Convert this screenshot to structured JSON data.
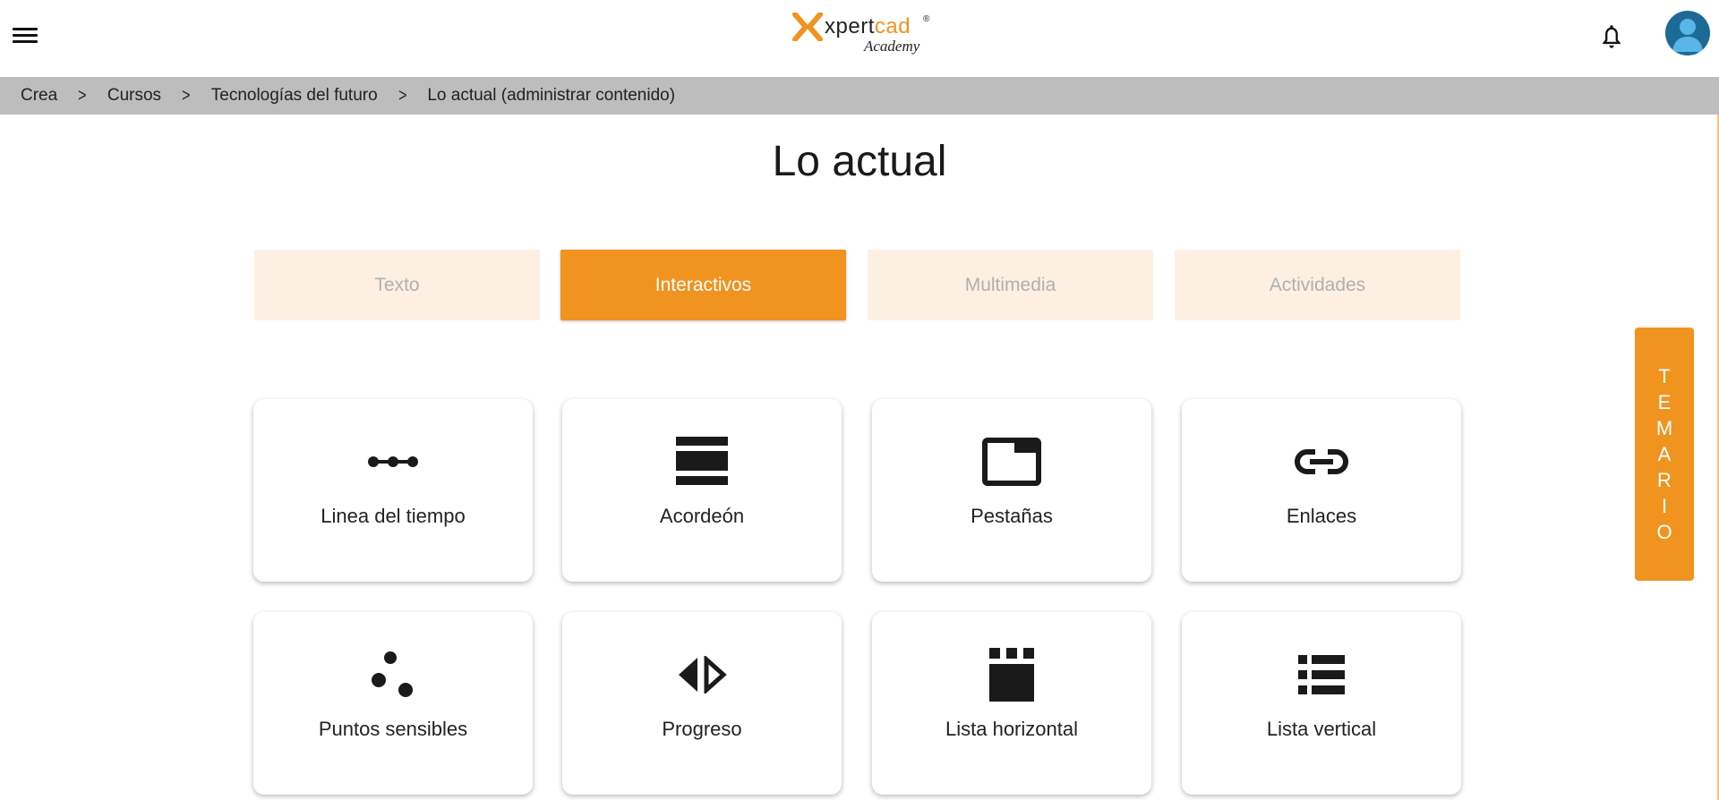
{
  "header": {
    "logo": {
      "brand_dark": "xpert",
      "brand_orange": "cad",
      "reg": "®",
      "sub": "Academy"
    },
    "menu_icon": "hamburger-icon",
    "notification_icon": "bell-icon",
    "avatar_icon": "user-avatar-icon"
  },
  "breadcrumb": {
    "items": [
      "Crea",
      "Cursos",
      "Tecnologías del futuro",
      "Lo actual (administrar contenido)"
    ],
    "separator": ">"
  },
  "page": {
    "title": "Lo actual"
  },
  "tabs": [
    {
      "label": "Texto",
      "active": false
    },
    {
      "label": "Interactivos",
      "active": true
    },
    {
      "label": "Multimedia",
      "active": false
    },
    {
      "label": "Actividades",
      "active": false
    }
  ],
  "cards": [
    {
      "label": "Linea del tiempo",
      "icon": "timeline-icon"
    },
    {
      "label": "Acordeón",
      "icon": "accordion-icon"
    },
    {
      "label": "Pestañas",
      "icon": "tabs-icon"
    },
    {
      "label": "Enlaces",
      "icon": "link-icon"
    },
    {
      "label": "Puntos sensibles",
      "icon": "hotspots-icon"
    },
    {
      "label": "Progreso",
      "icon": "progress-icon"
    },
    {
      "label": "Lista horizontal",
      "icon": "horizontal-list-icon"
    },
    {
      "label": "Lista vertical",
      "icon": "vertical-list-icon"
    }
  ],
  "side_tab": {
    "label": "TEMARIO"
  },
  "colors": {
    "accent": "#f0931f",
    "tab_inactive_bg": "#fdf0e2",
    "breadcrumb_bg": "#bdbdbd"
  }
}
